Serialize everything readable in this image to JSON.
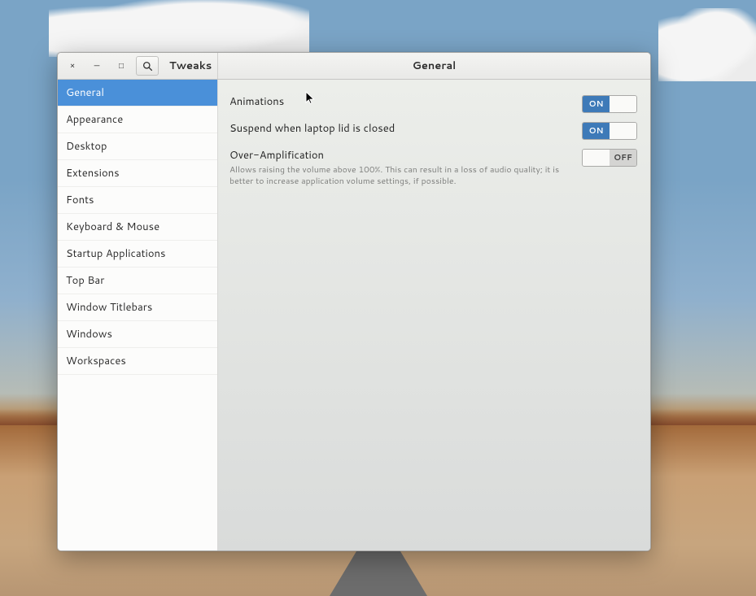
{
  "app_title": "Tweaks",
  "page_title": "General",
  "window_controls": {
    "close": "×",
    "minimize": "—",
    "maximize": "□"
  },
  "sidebar": {
    "items": [
      {
        "label": "General",
        "active": true
      },
      {
        "label": "Appearance",
        "active": false
      },
      {
        "label": "Desktop",
        "active": false
      },
      {
        "label": "Extensions",
        "active": false
      },
      {
        "label": "Fonts",
        "active": false
      },
      {
        "label": "Keyboard & Mouse",
        "active": false
      },
      {
        "label": "Startup Applications",
        "active": false
      },
      {
        "label": "Top Bar",
        "active": false
      },
      {
        "label": "Window Titlebars",
        "active": false
      },
      {
        "label": "Windows",
        "active": false
      },
      {
        "label": "Workspaces",
        "active": false
      }
    ]
  },
  "settings": [
    {
      "label": "Animations",
      "desc": "",
      "state": "on"
    },
    {
      "label": "Suspend when laptop lid is closed",
      "desc": "",
      "state": "on"
    },
    {
      "label": "Over-Amplification",
      "desc": "Allows raising the volume above 100%. This can result in a loss of audio quality; it is better to increase application volume settings, if possible.",
      "state": "off"
    }
  ],
  "switch_labels": {
    "on": "ON",
    "off": "OFF"
  }
}
